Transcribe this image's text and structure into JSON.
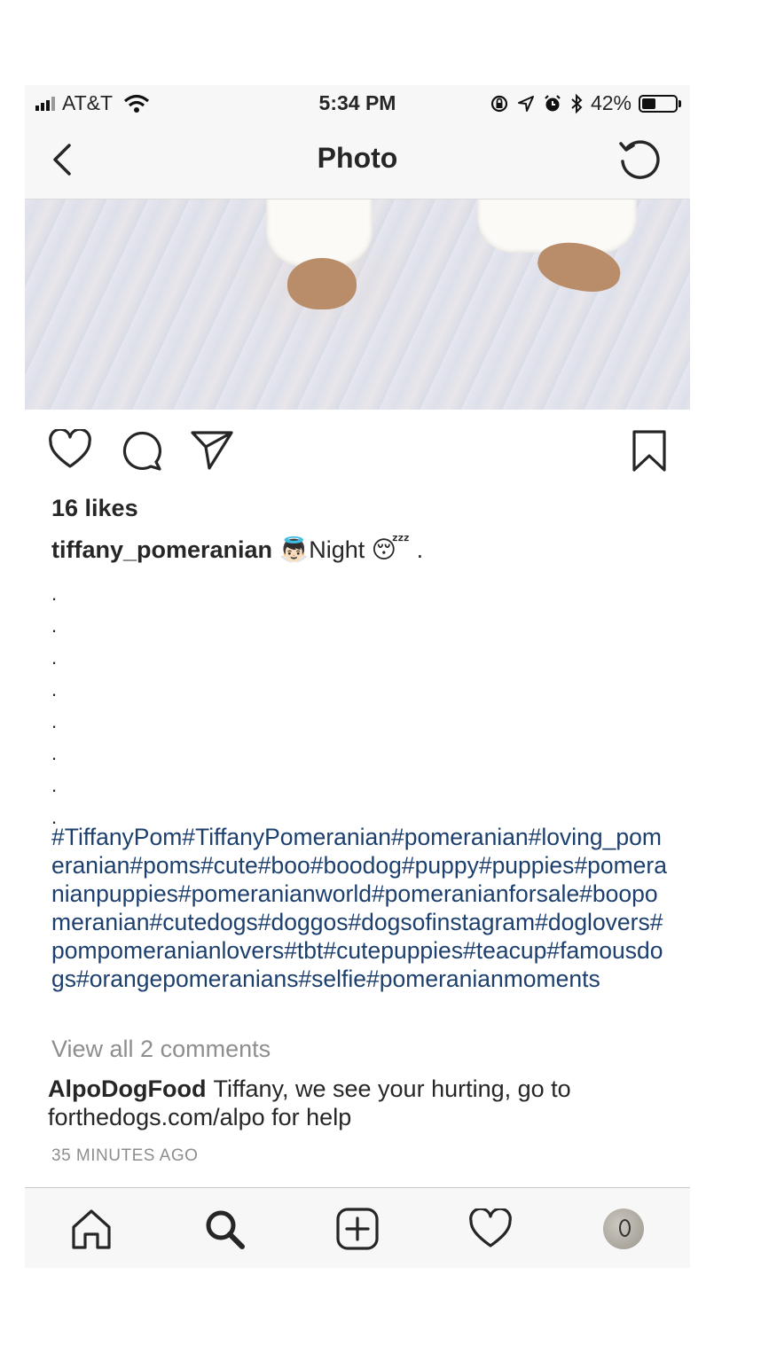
{
  "status_bar": {
    "carrier": "AT&T",
    "time": "5:34 PM",
    "battery_percent": "42%",
    "battery_level": 0.42,
    "icons": [
      "signal-icon",
      "wifi-icon",
      "rotation-lock-icon",
      "location-icon",
      "alarm-icon",
      "bluetooth-icon",
      "battery-icon"
    ]
  },
  "nav": {
    "title": "Photo",
    "back_icon": "chevron-left-icon",
    "reload_icon": "reload-icon"
  },
  "post": {
    "actions": [
      "heart-icon",
      "comment-icon",
      "share-icon",
      "bookmark-icon"
    ],
    "likes": "16 likes",
    "username": "tiffany_pomeranian",
    "caption_text": "Night",
    "caption_emojis": [
      "👼🏻",
      "😴"
    ],
    "caption_end": ".",
    "dot_lines": [
      ".",
      ".",
      ".",
      ".",
      ".",
      ".",
      ".",
      "."
    ],
    "hashtags": "#TiffanyPom#TiffanyPomeranian#pomeranian#loving_pomeranian#poms#cute#boo#boodog#puppy#puppies#pomeranianpuppies#pomeranianworld#pomeranianforsale#boopomeranian#cutedogs#doggos#dogsofinstagram#doglovers#pompomeranianlovers#tbt#cutepuppies#teacup#famousdogs#orangepomeranians#selfie#pomeranianmoments",
    "view_all_comments": "View all 2 comments",
    "comment": {
      "username": "AlpoDogFood",
      "text": "Tiffany, we see your hurting, go to forthedogs.com/alpo for help"
    },
    "time_ago": "35 MINUTES AGO"
  },
  "tab_bar": {
    "items": [
      "home-icon",
      "search-icon",
      "add-post-icon",
      "activity-heart-icon",
      "profile-avatar"
    ]
  },
  "colors": {
    "hashtag": "#1c3f6e",
    "muted": "#8e8e8e",
    "bar_background": "#f7f7f7"
  }
}
